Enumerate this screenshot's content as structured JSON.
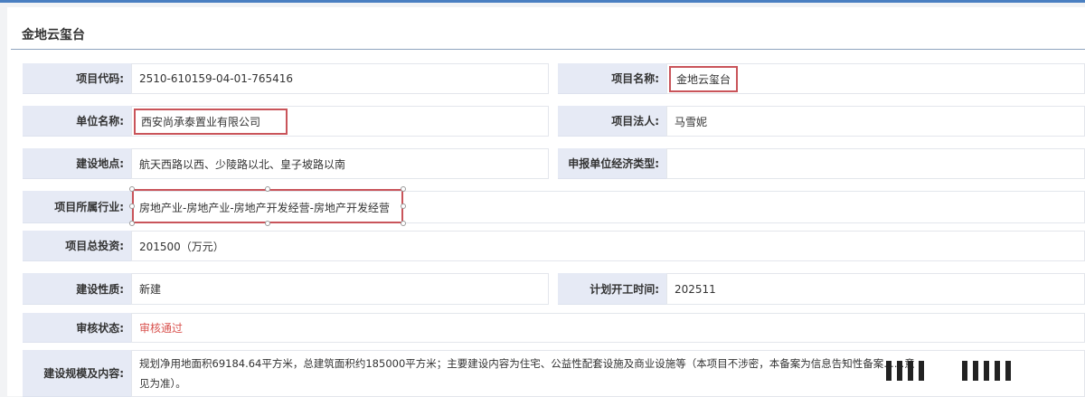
{
  "title": "金地云玺台",
  "fields": {
    "code": {
      "label": "项目代码:",
      "value": "2510-610159-04-01-765416"
    },
    "name": {
      "label": "项目名称:",
      "value": "金地云玺台"
    },
    "unit": {
      "label": "单位名称:",
      "value": "西安尚承泰置业有限公司"
    },
    "legal": {
      "label": "项目法人:",
      "value": "马雪妮"
    },
    "location": {
      "label": "建设地点:",
      "value": "航天西路以西、少陵路以北、皇子坡路以南"
    },
    "econ": {
      "label": "申报单位经济类型:",
      "value": ""
    },
    "industry": {
      "label": "项目所属行业:",
      "value": "房地产业-房地产业-房地产开发经营-房地产开发经营"
    },
    "investment": {
      "label": "项目总投资:",
      "value": "201500（万元）"
    },
    "nature": {
      "label": "建设性质:",
      "value": "新建"
    },
    "start": {
      "label": "计划开工时间:",
      "value": "202511"
    },
    "status": {
      "label": "审核状态:",
      "value": "审核通过"
    },
    "scale": {
      "label": "建设规模及内容:",
      "value1": "规划净用地面积69184.64平方米，总建筑面积约185000平方米；主要建设内容为住宅、公益性配套设施及商业设施等（本项目不涉密，本备案为信息告知性备案……意",
      "value2": "见为准）。"
    }
  }
}
